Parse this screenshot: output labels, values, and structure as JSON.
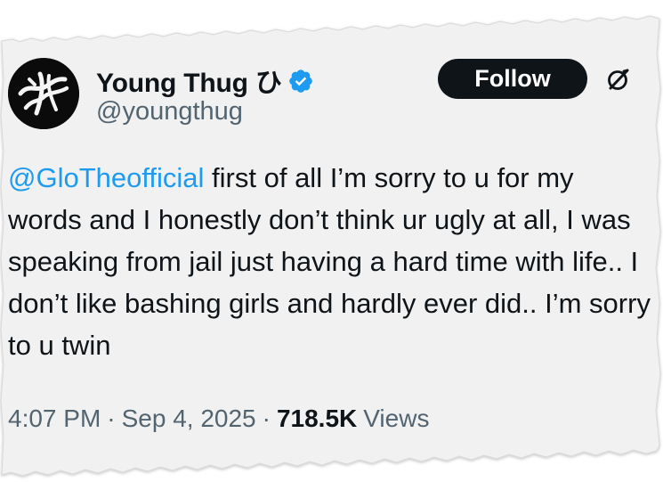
{
  "author": {
    "display_name": "Young Thug ひ",
    "handle": "@youngthug",
    "verified_icon": "verified-badge-icon",
    "avatar_icon": "avatar-logo"
  },
  "actions": {
    "follow_label": "Follow",
    "grok_icon": "grok-icon"
  },
  "tweet": {
    "mention": "@GloTheofficial",
    "body": " first of all I’m sorry to u for my words and I honestly don’t think ur ugly at all, I was speaking from jail just having a hard time with life.. I don’t like bashing girls and hardly ever did.. I’m sorry to u twin"
  },
  "meta": {
    "time": "4:07 PM",
    "separator": "·",
    "date": "Sep 4, 2025",
    "views_count": "718.5K",
    "views_label": "Views"
  },
  "colors": {
    "paper": "#f1f1f1",
    "text": "#0f1419",
    "secondary_text": "#536471",
    "link": "#1d9bf0",
    "verified": "#1d9bf0",
    "follow_bg": "#0f1419"
  }
}
